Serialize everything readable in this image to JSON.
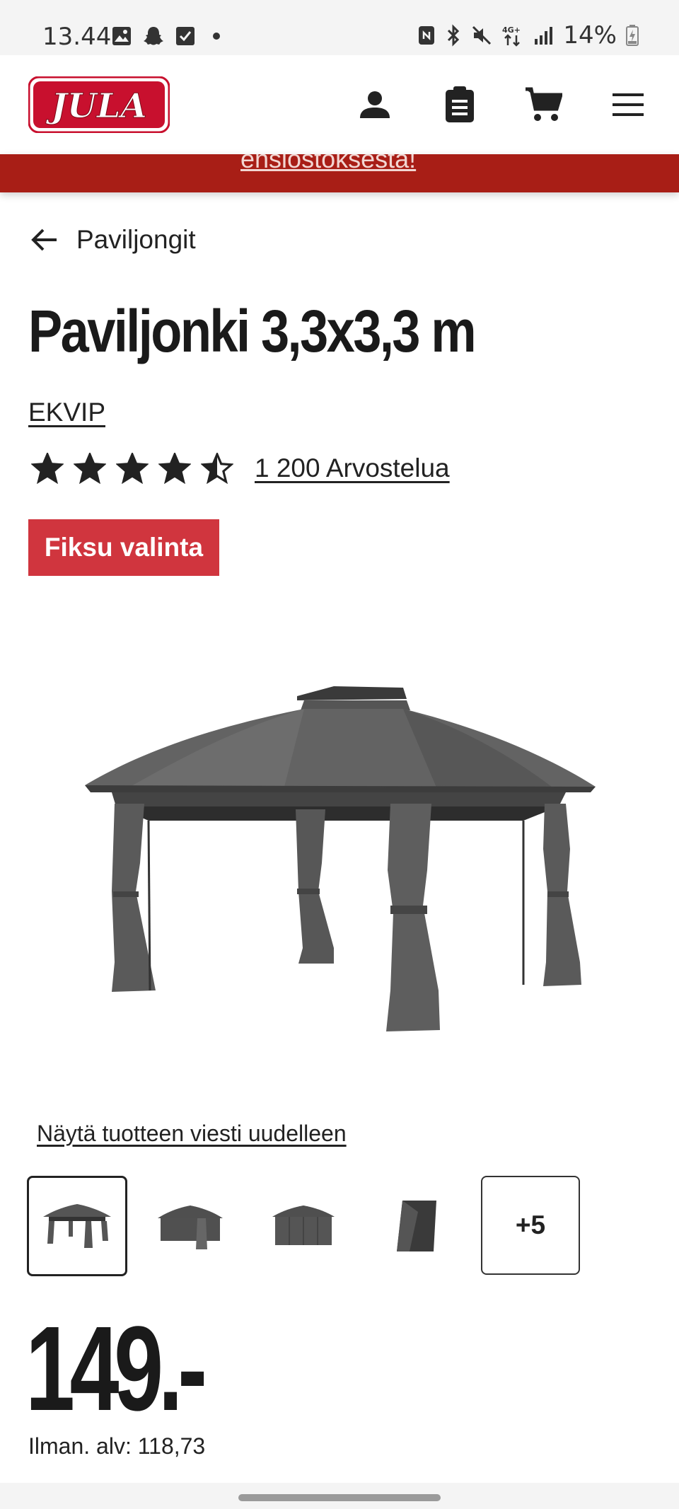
{
  "status_bar": {
    "time": "13.44",
    "battery": "14%",
    "network": "4G+",
    "left_icons": [
      "gallery-icon",
      "snapchat-icon",
      "checkbox-icon",
      "dot-icon"
    ],
    "right_icons": [
      "nfc-icon",
      "bluetooth-icon",
      "mute-icon",
      "network-icon",
      "signal-icon",
      "battery-icon"
    ]
  },
  "header": {
    "logo_text": "JULA",
    "icons": [
      "user-icon",
      "clipboard-icon",
      "cart-icon",
      "menu-icon"
    ],
    "brand_color": "#c8102e"
  },
  "promo": {
    "text": "ensiostoksesta!",
    "color": "#a81e16"
  },
  "breadcrumb": {
    "label": "Paviljongit"
  },
  "product": {
    "title": "Paviljonki 3,3x3,3 m",
    "brand": "EKVIP",
    "rating": 4.5,
    "rating_max": 5,
    "reviews": "1 200 Arvostelua",
    "badge": "Fiksu valinta",
    "badge_color": "#d0353e",
    "show_message_link": "Näytä tuotteen viesti uudelleen",
    "more_images": "+5",
    "price": "149.-",
    "price_ex_vat": "Ilman. alv: 118,73"
  }
}
